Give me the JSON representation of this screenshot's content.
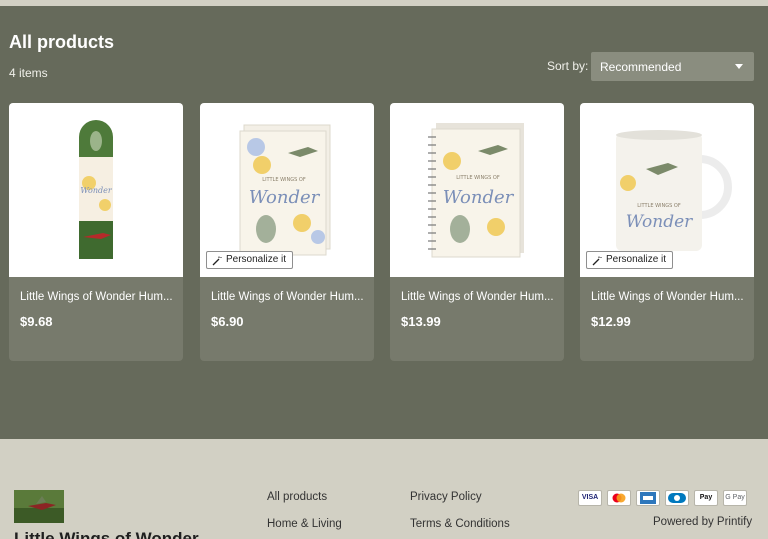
{
  "page": {
    "title": "All products",
    "count": "4 items",
    "sort_label": "Sort by:",
    "sort_value": "Recommended"
  },
  "products": [
    {
      "name": "Little Wings of Wonder Hum...",
      "price": "$9.68",
      "personalize": ""
    },
    {
      "name": "Little Wings of Wonder Hum...",
      "price": "$6.90",
      "personalize": "Personalize it"
    },
    {
      "name": "Little Wings of Wonder Hum...",
      "price": "$13.99",
      "personalize": ""
    },
    {
      "name": "Little Wings of Wonder Hum...",
      "price": "$12.99",
      "personalize": "Personalize it"
    }
  ],
  "footer": {
    "brand": "Little Wings of Wonder",
    "links_col1": [
      "All products",
      "Home & Living"
    ],
    "links_col2": [
      "Privacy Policy",
      "Terms & Conditions"
    ],
    "payments": [
      "VISA",
      "mastercard",
      "amex",
      "diners",
      "Apple Pay",
      "G Pay"
    ],
    "payment_labels": {
      "visa": "VISA",
      "applepay": "Pay",
      "gpay": "G Pay"
    },
    "powered": "Powered by Printify"
  },
  "colors": {
    "main_bg": "#666a5b",
    "card_bg": "#777a6c",
    "footer_bg": "#d2d0c4",
    "select_bg": "#8a8d7f"
  }
}
